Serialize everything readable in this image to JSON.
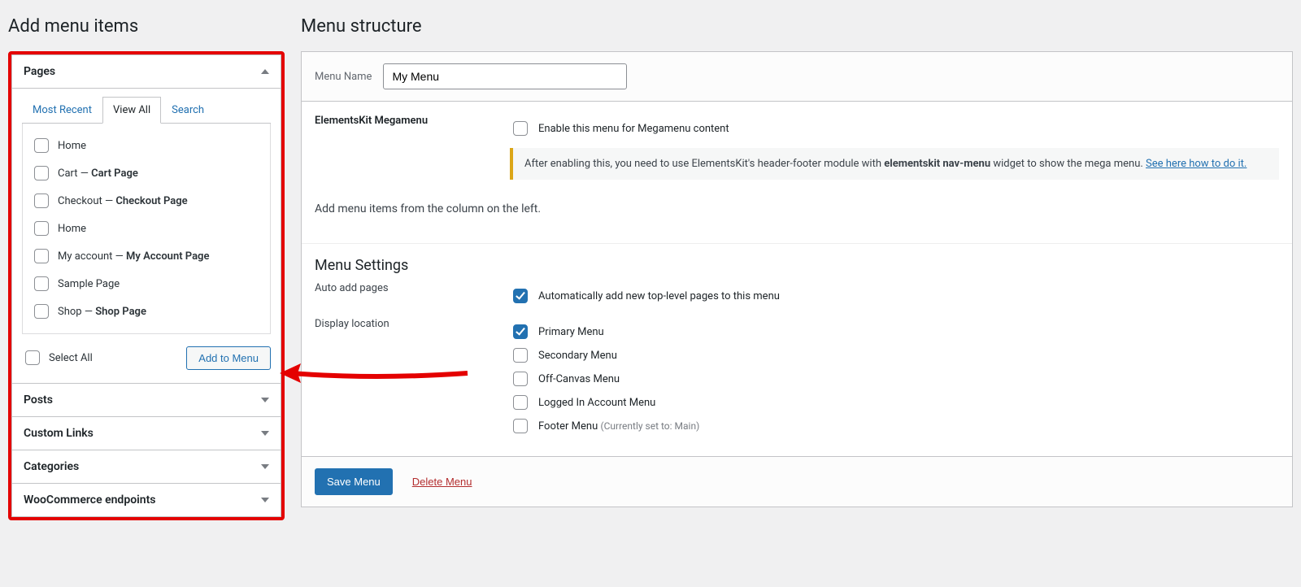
{
  "left": {
    "heading": "Add menu items",
    "pages": {
      "title": "Pages",
      "tabs": {
        "recent": "Most Recent",
        "viewall": "View All",
        "search": "Search"
      },
      "items": [
        {
          "pre": "Home",
          "bold": ""
        },
        {
          "pre": "Cart — ",
          "bold": "Cart Page"
        },
        {
          "pre": "Checkout — ",
          "bold": "Checkout Page"
        },
        {
          "pre": "Home",
          "bold": ""
        },
        {
          "pre": "My account — ",
          "bold": "My Account Page"
        },
        {
          "pre": "Sample Page",
          "bold": ""
        },
        {
          "pre": "Shop — ",
          "bold": "Shop Page"
        }
      ],
      "select_all": "Select All",
      "add_btn": "Add to Menu"
    },
    "posts": "Posts",
    "custom_links": "Custom Links",
    "categories": "Categories",
    "woo": "WooCommerce endpoints"
  },
  "right": {
    "heading": "Menu structure",
    "menu_name_label": "Menu Name",
    "menu_name_value": "My Menu",
    "megamenu": {
      "label": "ElementsKit Megamenu",
      "enable_label": "Enable this menu for Megamenu content",
      "notice_pre": "After enabling this, you need to use ElementsKit's header-footer module with ",
      "notice_bold": "elementskit nav-menu",
      "notice_post": " widget to show the mega menu. ",
      "notice_link": "See here how to do it."
    },
    "instruction": "Add menu items from the column on the left.",
    "settings": {
      "heading": "Menu Settings",
      "auto_label": "Auto add pages",
      "auto_option": "Automatically add new top-level pages to this menu",
      "loc_label": "Display location",
      "locations": {
        "primary": "Primary Menu",
        "secondary": "Secondary Menu",
        "offcanvas": "Off-Canvas Menu",
        "logged": "Logged In Account Menu",
        "footer": "Footer Menu ",
        "footer_note": "(Currently set to: Main)"
      }
    },
    "save": "Save Menu",
    "delete": "Delete Menu"
  }
}
